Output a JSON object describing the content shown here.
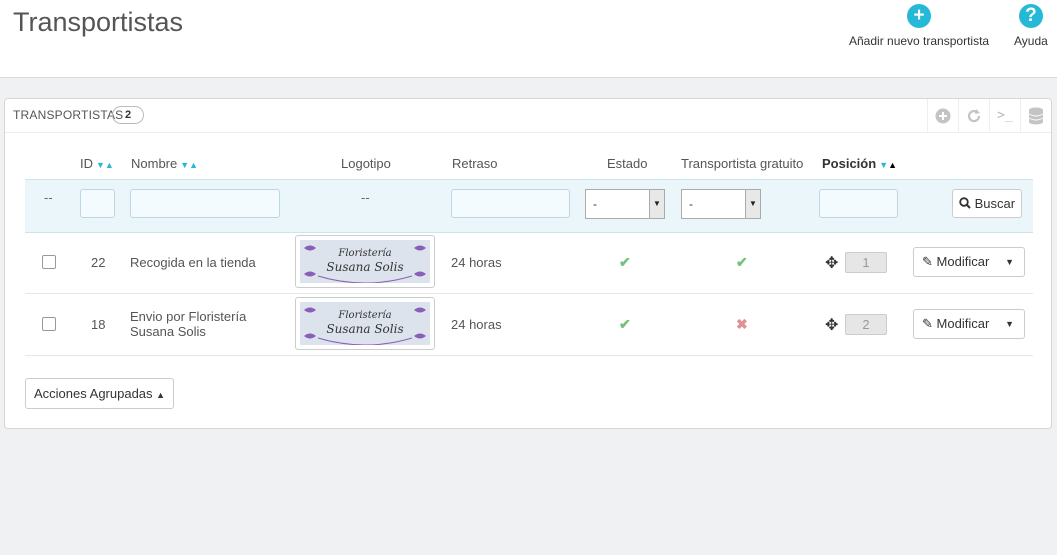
{
  "header": {
    "title": "Transportistas",
    "add_icon": "plus-circle-icon",
    "add_label": "Añadir nuevo transportista",
    "help_icon": "question-circle-icon",
    "help_label": "Ayuda"
  },
  "panel": {
    "title": "TRANSPORTISTAS",
    "count": "2",
    "icons": [
      "add-icon",
      "refresh-icon",
      "sql-query-icon",
      "export-database-icon"
    ]
  },
  "columns": {
    "id": "ID",
    "nombre": "Nombre",
    "logotipo": "Logotipo",
    "retraso": "Retraso",
    "estado": "Estado",
    "gratuito": "Transportista gratuito",
    "posicion": "Posición"
  },
  "filters": {
    "checkbox_col": "--",
    "logo": "--",
    "estado_value": "-",
    "gratuito_value": "-",
    "search_label": "Buscar"
  },
  "logo_text": {
    "line1": "Floristería",
    "line2": "Susana Solis"
  },
  "rows": [
    {
      "id": "22",
      "name_line1": "Recogida en la tienda",
      "name_line2": "",
      "delay": "24 horas",
      "estado": "check",
      "gratuito": "check",
      "position": "1",
      "action": "Modificar"
    },
    {
      "id": "18",
      "name_line1": "Envio por Floristería",
      "name_line2": "Susana Solis",
      "delay": "24 horas",
      "estado": "check",
      "gratuito": "cross",
      "position": "2",
      "action": "Modificar"
    }
  ],
  "bulk_actions_label": "Acciones Agrupadas",
  "colors": {
    "accent": "#25b9d7",
    "check": "#72c279",
    "cross": "#e08f95"
  }
}
